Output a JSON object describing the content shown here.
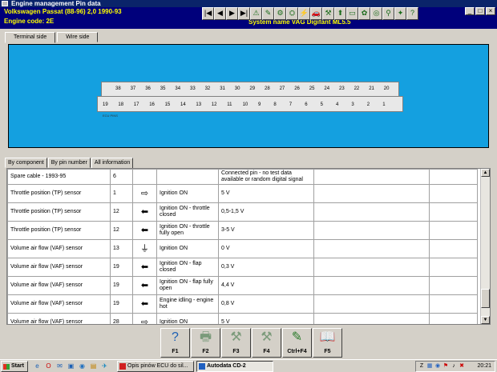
{
  "window": {
    "title": "Engine management Pin data"
  },
  "vehicle": {
    "line": "Volkswagen    Passat (88-96) 2,0    1990-93",
    "engine_code": "Engine code: 2E",
    "system": "System name VAG Digifant ML5.5"
  },
  "toolbar": {
    "icons": [
      "first-page-icon",
      "prev-page-icon",
      "next-page-icon",
      "last-page-icon",
      "warning-icon",
      "tools-icon",
      "wiring-icon",
      "engine-icon",
      "timing-icon",
      "car-icon",
      "settings-icon",
      "injector-icon",
      "battery-icon",
      "oil-icon",
      "gauge-icon",
      "plug-icon",
      "filter-icon",
      "help-icon"
    ],
    "glyphs": [
      "|◀",
      "◀",
      "▶",
      "▶|",
      "⚠",
      "✎",
      "⚙",
      "⛭",
      "⚡",
      "🚗",
      "⚒",
      "⬆",
      "▭",
      "✿",
      "◎",
      "⚲",
      "✦",
      "?"
    ]
  },
  "window_controls": {
    "minimize": "_",
    "maximize": "□",
    "close": "×"
  },
  "upper_tabs": [
    "Terminal side",
    "Wire side"
  ],
  "connector": {
    "top_row": [
      "38",
      "37",
      "36",
      "35",
      "34",
      "33",
      "32",
      "31",
      "30",
      "29",
      "28",
      "27",
      "26",
      "25",
      "24",
      "23",
      "22",
      "21",
      "20"
    ],
    "bottom_row": [
      "19",
      "18",
      "17",
      "16",
      "15",
      "14",
      "13",
      "12",
      "11",
      "10",
      "9",
      "8",
      "7",
      "6",
      "5",
      "4",
      "3",
      "2",
      "1"
    ],
    "label": "ECU PINS"
  },
  "lower_tabs": [
    "By component",
    "By pin number",
    "All information"
  ],
  "table": {
    "rows": [
      {
        "component": "Spare cable - 1993-95",
        "pin": "6",
        "arrow": "",
        "condition": "",
        "value": "Connected pin - no test data available or random digital signal"
      },
      {
        "component": "Throttle position (TP) sensor",
        "pin": "1",
        "arrow": "⇨",
        "condition": "Ignition ON",
        "value": "5 V"
      },
      {
        "component": "Throttle position (TP) sensor",
        "pin": "12",
        "arrow": "⬅",
        "condition": "Ignition ON - throttle closed",
        "value": "0,5-1,5 V"
      },
      {
        "component": "Throttle position (TP) sensor",
        "pin": "12",
        "arrow": "⬅",
        "condition": "Ignition ON - throttle fully open",
        "value": "3-5 V"
      },
      {
        "component": "Volume air flow (VAF) sensor",
        "pin": "13",
        "arrow": "⏚",
        "condition": "Ignition ON",
        "value": "0 V"
      },
      {
        "component": "Volume air flow (VAF) sensor",
        "pin": "19",
        "arrow": "⬅",
        "condition": "Ignition ON - flap closed",
        "value": "0,3 V"
      },
      {
        "component": "Volume air flow (VAF) sensor",
        "pin": "19",
        "arrow": "⬅",
        "condition": "Ignition ON - flap fully open",
        "value": "4,4 V"
      },
      {
        "component": "Volume air flow (VAF) sensor",
        "pin": "19",
        "arrow": "⬅",
        "condition": "Engine idling - engine hot",
        "value": "0,8 V"
      },
      {
        "component": "Volume air flow (VAF) sensor",
        "pin": "28",
        "arrow": "⇨",
        "condition": "Ignition ON",
        "value": "5 V"
      }
    ]
  },
  "fkeys": [
    {
      "label": "F1",
      "icon": "help-icon",
      "glyph": "?"
    },
    {
      "label": "F2",
      "icon": "print-icon",
      "glyph": "🖶"
    },
    {
      "label": "F3",
      "icon": "tools-icon",
      "glyph": "⚒"
    },
    {
      "label": "F4",
      "icon": "tools-icon",
      "glyph": "⚒"
    },
    {
      "label": "Ctrl+F4",
      "icon": "document-icon",
      "glyph": "✎"
    },
    {
      "label": "F5",
      "icon": "book-icon",
      "glyph": "📖"
    }
  ],
  "taskbar": {
    "start": "Start",
    "tasks": [
      {
        "label": "Opis pinów ECU do sil..."
      },
      {
        "label": "Autodata CD-2"
      }
    ],
    "clock": "20:21"
  },
  "colors": {
    "connector_bg": "#14a0e0",
    "title_bg": "#0a246a",
    "info_bg": "#00007b",
    "info_text": "#ffff00"
  }
}
